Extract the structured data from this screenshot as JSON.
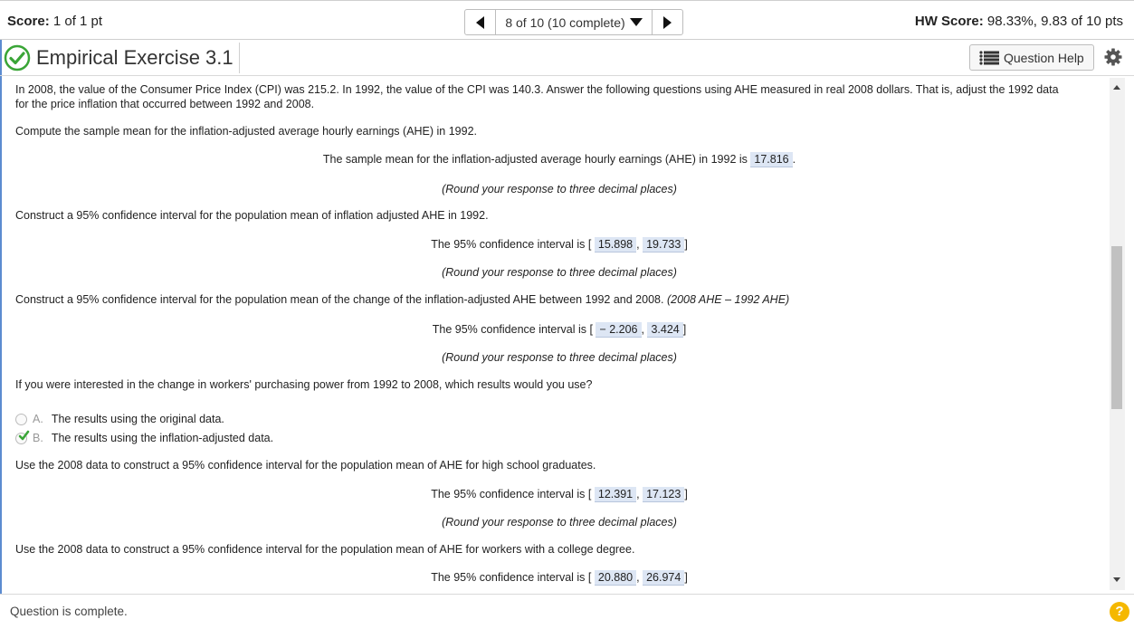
{
  "header": {
    "score_label": "Score:",
    "score_value": "1 of 1 pt",
    "position": "8 of 10 (10 complete)",
    "hw_score_label": "HW Score:",
    "hw_score_value": "98.33%, 9.83 of 10 pts"
  },
  "titlebar": {
    "title": "Empirical Exercise 3.1",
    "help_label": "Question Help"
  },
  "content": {
    "intro_line1": "In 2008, the value of the Consumer Price Index (CPI) was 215.2. In 1992, the value of the CPI was 140.3. Answer the following questions using AHE measured in real 2008 dollars. That is, adjust the 1992 data",
    "intro_line2": "for the price inflation that occurred between 1992 and 2008.",
    "q1": "Compute the sample mean for the inflation-adjusted average hourly earnings (AHE) in 1992.",
    "a1_prefix": "The sample mean for the inflation-adjusted average hourly earnings (AHE) in 1992 is",
    "a1_value": "17.816",
    "a1_suffix": ".",
    "round_note": "(Round your response to three decimal places)",
    "q2": "Construct a 95% confidence interval for the population mean of inflation adjusted AHE in 1992.",
    "ci_prefix": "The 95% confidence interval is [",
    "ci_sep": ",",
    "ci_close": "]",
    "a2_low": "15.898",
    "a2_high": "19.733",
    "q3_text": "Construct a 95% confidence interval for the population mean of the change of the inflation-adjusted AHE between 1992 and 2008.",
    "q3_note": "(2008 AHE – 1992 AHE)",
    "a3_low": "− 2.206",
    "a3_high": "3.424",
    "q4": "If you were interested in the change in workers' purchasing power from 1992 to 2008, which results would you use?",
    "optA_letter": "A.",
    "optA_text": "The results using the original data.",
    "optB_letter": "B.",
    "optB_text": "The results using the inflation-adjusted data.",
    "q5": "Use the 2008 data to construct a 95% confidence interval for the population mean of AHE for high school graduates.",
    "a5_low": "12.391",
    "a5_high": "17.123",
    "q6": "Use the 2008 data to construct a 95% confidence interval for the population mean of AHE for workers with a college degree.",
    "a6_low": "20.880",
    "a6_high": "26.974"
  },
  "footer": {
    "status": "Question is complete.",
    "help_glyph": "?"
  },
  "colors": {
    "accent_green": "#3aa537",
    "answer_bg": "#dde6f4",
    "help_yellow": "#f5b800"
  }
}
